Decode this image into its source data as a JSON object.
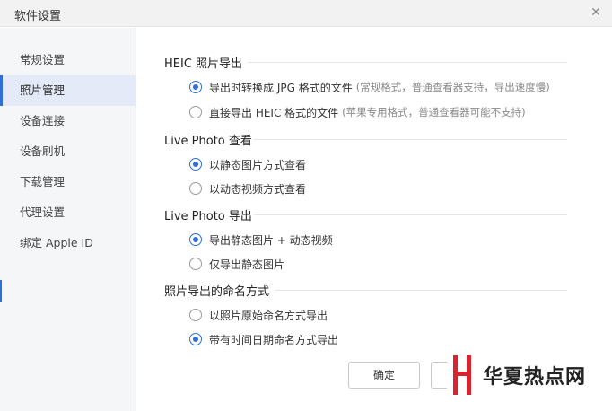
{
  "window": {
    "title": "软件设置"
  },
  "sidebar": {
    "items": [
      {
        "label": "常规设置",
        "active": false
      },
      {
        "label": "照片管理",
        "active": true
      },
      {
        "label": "设备连接",
        "active": false
      },
      {
        "label": "设备刷机",
        "active": false
      },
      {
        "label": "下载管理",
        "active": false
      },
      {
        "label": "代理设置",
        "active": false
      },
      {
        "label": "绑定 Apple ID",
        "active": false
      }
    ]
  },
  "sections": [
    {
      "title": "HEIC 照片导出",
      "options": [
        {
          "label": "导出时转换成 JPG 格式的文件",
          "note": "(常规格式，普通查看器支持，导出速度慢)",
          "checked": true
        },
        {
          "label": "直接导出 HEIC 格式的文件",
          "note": "(苹果专用格式，普通查看器可能不支持)",
          "checked": false
        }
      ]
    },
    {
      "title": "Live Photo 查看",
      "options": [
        {
          "label": "以静态图片方式查看",
          "note": "",
          "checked": true
        },
        {
          "label": "以动态视频方式查看",
          "note": "",
          "checked": false
        }
      ]
    },
    {
      "title": "Live Photo 导出",
      "options": [
        {
          "label": "导出静态图片 + 动态视频",
          "note": "",
          "checked": true
        },
        {
          "label": "仅导出静态图片",
          "note": "",
          "checked": false
        }
      ]
    },
    {
      "title": "照片导出的命名方式",
      "options": [
        {
          "label": "以照片原始命名方式导出",
          "note": "",
          "checked": false
        },
        {
          "label": "带有时间日期命名方式导出",
          "note": "",
          "checked": true
        }
      ]
    }
  ],
  "buttons": {
    "confirm": "确定"
  },
  "watermark": {
    "text": "华夏热点网"
  },
  "colors": {
    "accent": "#2f6fd7",
    "sidebar_bg": "#f5f6f8",
    "active_bg": "#e4eaf7",
    "watermark_red": "#d9232e"
  },
  "icons": {
    "close": "close-icon",
    "watermark_logo": "watermark-logo-icon"
  }
}
